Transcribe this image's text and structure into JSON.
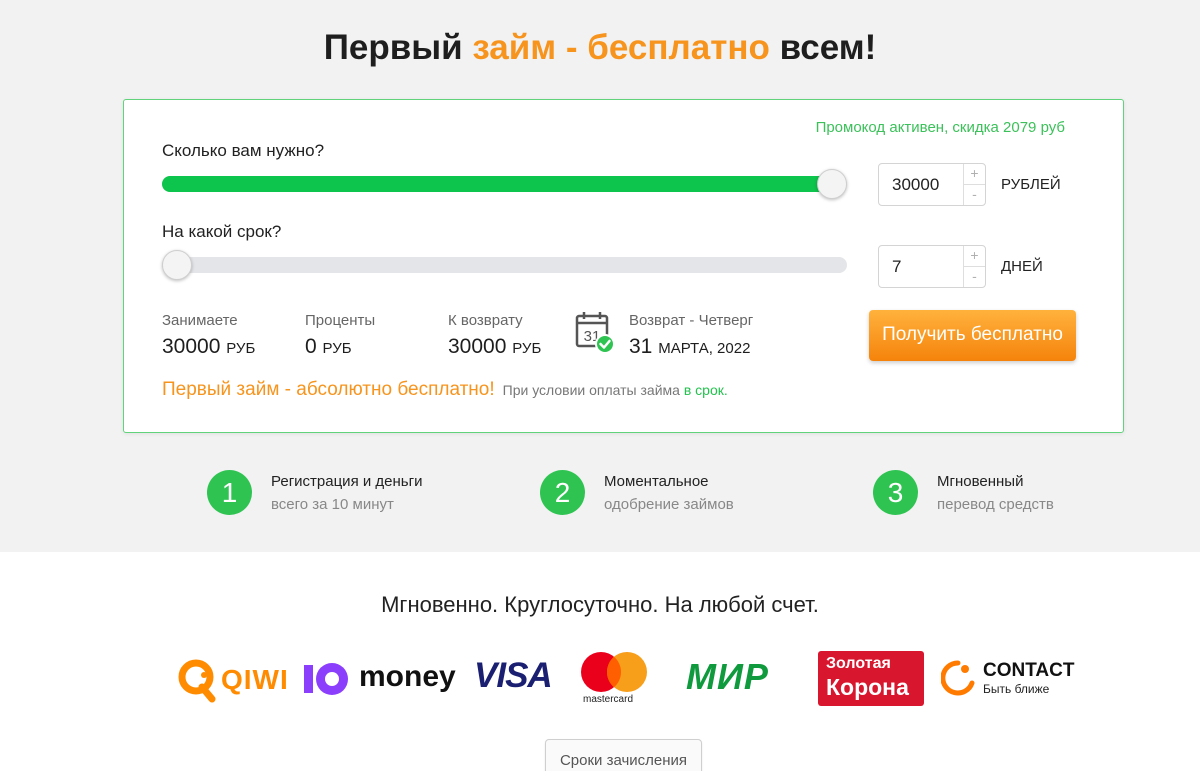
{
  "header": {
    "title_part1": "Первый ",
    "title_accent": "займ - бесплатно",
    "title_part2": " всем!"
  },
  "calculator": {
    "promo": "Промокод активен, скидка 2079 руб",
    "amount": {
      "question": "Сколько вам нужно?",
      "value": "30000",
      "unit": "РУБЛЕЙ",
      "slider_fraction": 1.0,
      "plus": "+",
      "minus": "-"
    },
    "term": {
      "question": "На какой срок?",
      "value": "7",
      "unit": "ДНЕЙ",
      "slider_fraction": 0.0,
      "plus": "+",
      "minus": "-"
    },
    "summary": {
      "borrow_label": "Занимаете",
      "borrow_value": "30000",
      "borrow_unit": "РУБ",
      "interest_label": "Проценты",
      "interest_value": "0",
      "interest_unit": "РУБ",
      "return_label": "К возврату",
      "return_value": "30000",
      "return_unit": "РУБ",
      "calendar_day": "31",
      "return_date_label": "Возврат - Четверг",
      "return_date_day": "31",
      "return_date_rest": "МАРТА, 2022"
    },
    "cta": "Получить бесплатно",
    "note_main": "Первый займ - абсолютно бесплатно!",
    "note_sub": "При условии оплаты займа ",
    "note_sub_green": "в срок."
  },
  "features": [
    {
      "num": "1",
      "line1": "Регистрация и деньги",
      "line2": "всего за 10 минут"
    },
    {
      "num": "2",
      "line1": "Моментальное",
      "line2": "одобрение займов"
    },
    {
      "num": "3",
      "line1": "Мгновенный",
      "line2": "перевод средств"
    }
  ],
  "payments": {
    "heading": "Мгновенно. Круглосуточно. На любой счет.",
    "qiwi": "QIWI",
    "yoomoney": "money",
    "visa": "VISA",
    "mastercard": "mastercard",
    "mir": "МИР",
    "zolotaya_korona_1": "Золотая",
    "zolotaya_korona_2": "Корона",
    "contact": "CONTACT",
    "contact_tagline": "Быть ближе",
    "button": "Сроки зачисления"
  },
  "colors": {
    "accent_orange": "#f7941d",
    "green": "#0dc44c",
    "card_border": "#61d37a"
  }
}
